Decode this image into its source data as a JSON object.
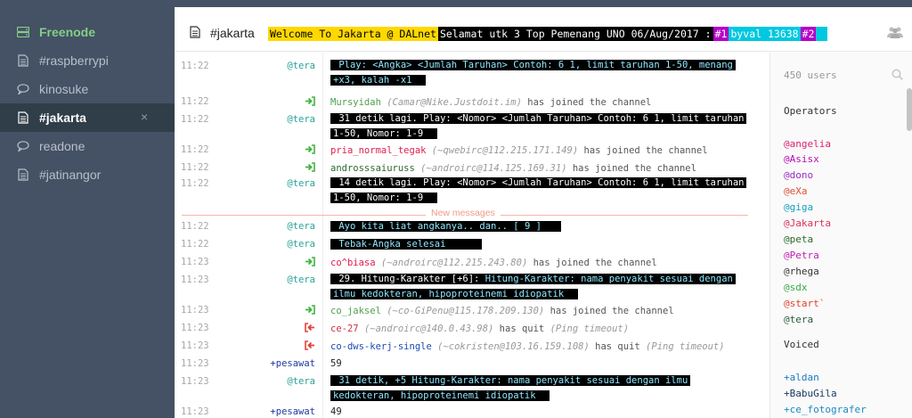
{
  "sidebar": {
    "items": [
      {
        "label": "Freenode",
        "icon": "network-icon"
      },
      {
        "label": "#raspberrypi",
        "icon": "channel-icon"
      },
      {
        "label": "kinosuke",
        "icon": "query-icon"
      },
      {
        "label": "#jakarta",
        "icon": "channel-icon",
        "close": "×"
      },
      {
        "label": "readone",
        "icon": "query-icon"
      },
      {
        "label": "#jatinangor",
        "icon": "channel-icon"
      }
    ]
  },
  "header": {
    "channel": "#jakarta",
    "topic": {
      "p1": "Welcome To Jakarta @ DALnet",
      "p2": " Selamat utk 3 Top Pemenang UNO 06/Aug/2017 : ",
      "p3": "#1",
      "p4": " byval 13638",
      "p5": "#2"
    }
  },
  "messages": {
    "new_messages_label": "New messages",
    "rows": [
      {
        "time": "11:22",
        "from": "@tera",
        "text": "Play: <Angka> <Jumlah Taruhan> Contoh: 6 1, limit taruhan 1-50, menang +x3, kalah -x1"
      },
      {
        "time": "11:22",
        "nick": "Mursyidah",
        "host": "(Camar@Nike.Justdoit.im)",
        "action": "has joined the channel"
      },
      {
        "time": "11:22",
        "from": "@tera",
        "text": "31 detik lagi. Play: <Nomor> <Jumlah Taruhan> Contoh: 6 1, limit taruhan 1-50, Nomor: 1-9"
      },
      {
        "time": "11:22",
        "nick": "pria_normal_tegak",
        "host": "(~qwebirc@112.215.171.149)",
        "action": "has joined the channel"
      },
      {
        "time": "11:22",
        "nick": "androsssaiuruss",
        "host": "(~androirc@114.125.169.31)",
        "action": "has joined the channel"
      },
      {
        "time": "11:22",
        "from": "@tera",
        "text": "14 detik lagi. Play: <Nomor> <Jumlah Taruhan> Contoh: 6 1, limit taruhan 1-50, Nomor: 1-9"
      },
      {
        "time": "11:22",
        "from": "@tera",
        "text": "Ayo kita liat angkanya.. dan.. [ 9 ]"
      },
      {
        "time": "11:22",
        "from": "@tera",
        "text": "Tebak-Angka selesai"
      },
      {
        "time": "11:23",
        "nick": "co^biasa",
        "host": "(~androirc@112.215.243.80)",
        "action": "has joined the channel"
      },
      {
        "time": "11:23",
        "from": "@tera",
        "text_a": "29. Hitung-Karakter [+6]:",
        "text_b": " Hitung-Karakter: nama penyakit sesuai dengan ilmu kedokteran, hipoproteinemi idiopatik"
      },
      {
        "time": "11:23",
        "nick": "co_jaksel",
        "host": "(~co-GiPenu@115.178.209.130)",
        "action": "has joined the channel"
      },
      {
        "time": "11:23",
        "nick": "ce-27",
        "host": "(~androirc@140.0.43.98)",
        "action": "has quit",
        "reason": "(Ping timeout)"
      },
      {
        "time": "11:23",
        "nick": "co-dws-kerj-single",
        "host": "(~cokristen@103.16.159.108)",
        "action": "has quit",
        "reason": "(Ping timeout)"
      },
      {
        "time": "11:23",
        "from": "+pesawat",
        "text": "59"
      },
      {
        "time": "11:23",
        "from": "@tera",
        "text": "31 detik, +5 Hitung-Karakter: nama penyakit sesuai dengan ilmu kedokteran, hipoproteinemi idiopatik"
      },
      {
        "time": "11:23",
        "from": "+pesawat",
        "text": "49"
      }
    ]
  },
  "userlist": {
    "count": "450 users",
    "operators_label": "Operators",
    "operators": [
      "@angelia",
      "@Asisx",
      "@dono",
      "@eXa",
      "@giga",
      "@Jakarta",
      "@peta",
      "@Petra",
      "@rhega",
      "@sdx",
      "@start`",
      "@tera"
    ],
    "voiced_label": "Voiced",
    "voiced": [
      "+aldan",
      "+BabuGila",
      "+ce_fotografer"
    ]
  },
  "colors": {
    "sidebar_bg": "#455164",
    "active_bg": "#303e4a",
    "network": "#84ce88",
    "join": "#3fb33f",
    "quit": "#e0423a"
  }
}
